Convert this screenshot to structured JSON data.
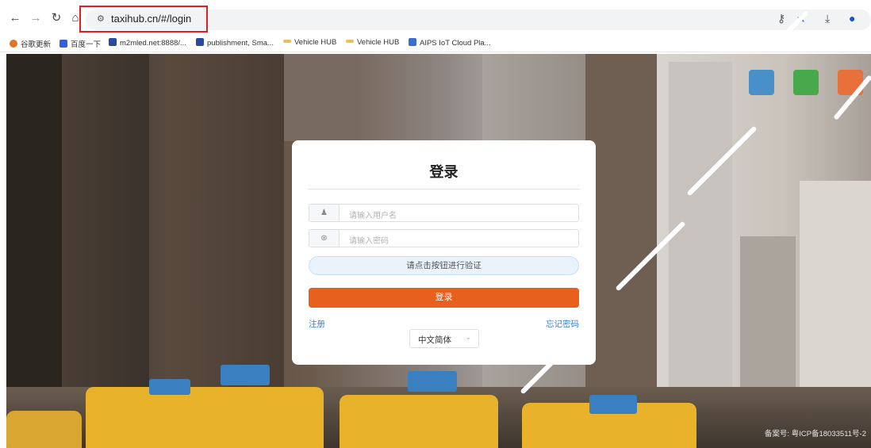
{
  "browser": {
    "url": "taxihub.cn/#/login",
    "bookmarks": [
      {
        "label": "谷歌更新",
        "color": "#e0742a"
      },
      {
        "label": "百度一下",
        "color": "#3660d9"
      },
      {
        "label": "m2mled.net:8888/...",
        "color": "#2a4aa0"
      },
      {
        "label": "publishment, Sma...",
        "color": "#2a4aa0"
      },
      {
        "label": "Vehicle HUB",
        "color": "#e8c05a"
      },
      {
        "label": "Vehicle HUB",
        "color": "#e8c05a"
      },
      {
        "label": "AIPS IoT Cloud Pla...",
        "color": "#3a6fcf"
      }
    ]
  },
  "login": {
    "title": "登录",
    "username_placeholder": "请输入用户名",
    "password_placeholder": "请输入密码",
    "verify_label": "请点击按钮进行验证",
    "submit_label": "登录",
    "register_link": "注册",
    "forgot_link": "忘记密码",
    "language": "中文简体"
  },
  "footer": {
    "icp": "备案号: 粤ICP备18033511号-2"
  },
  "colors": {
    "accent": "#e8601e",
    "link": "#3a7fd5",
    "highlight_box": "#e02020"
  }
}
